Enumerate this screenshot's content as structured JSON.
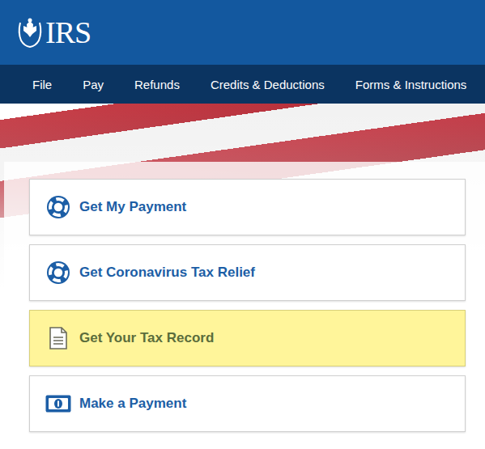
{
  "header": {
    "logo": "IRS"
  },
  "nav": {
    "items": [
      "File",
      "Pay",
      "Refunds",
      "Credits & Deductions",
      "Forms & Instructions"
    ]
  },
  "cards": [
    {
      "label": "Get My Payment",
      "kind": "lifebuoy",
      "highlighted": false
    },
    {
      "label": "Get Coronavirus Tax Relief",
      "kind": "lifebuoy",
      "highlighted": false
    },
    {
      "label": "Get Your Tax Record",
      "kind": "document",
      "highlighted": true
    },
    {
      "label": "Make a Payment",
      "kind": "money",
      "highlighted": false
    }
  ]
}
